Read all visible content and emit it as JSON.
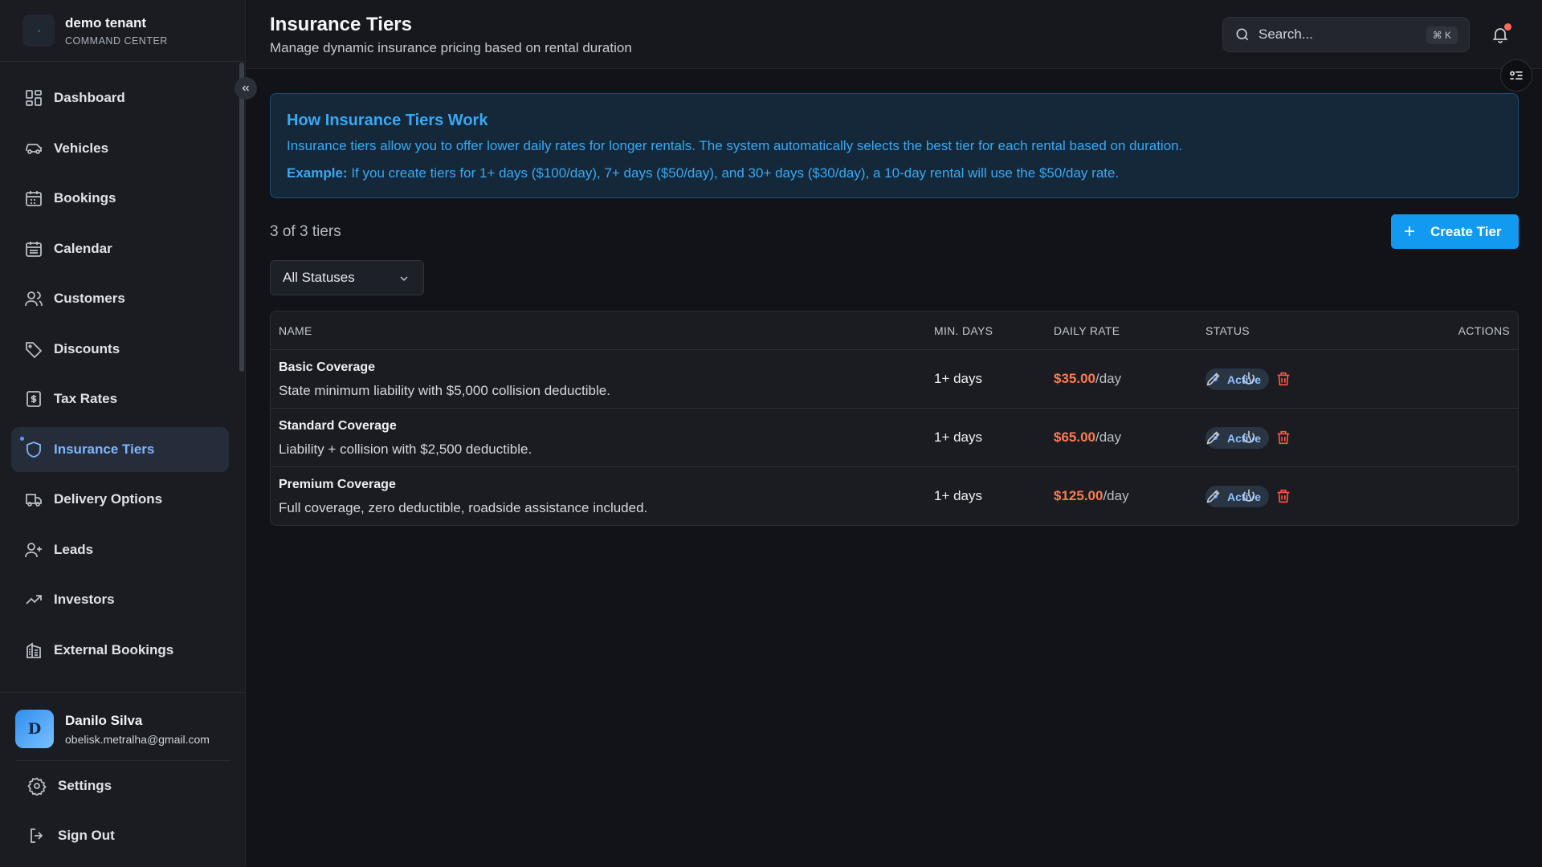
{
  "brand": {
    "title": "demo tenant",
    "subtitle": "COMMAND CENTER"
  },
  "sidebar": {
    "items": [
      {
        "label": "Dashboard",
        "icon": "dashboard-icon"
      },
      {
        "label": "Vehicles",
        "icon": "car-icon"
      },
      {
        "label": "Bookings",
        "icon": "calendar-icon"
      },
      {
        "label": "Calendar",
        "icon": "calendar-grid-icon"
      },
      {
        "label": "Customers",
        "icon": "users-icon"
      },
      {
        "label": "Discounts",
        "icon": "tag-icon"
      },
      {
        "label": "Tax Rates",
        "icon": "receipt-icon"
      },
      {
        "label": "Insurance Tiers",
        "icon": "shield-icon",
        "active": true
      },
      {
        "label": "Delivery Options",
        "icon": "truck-icon"
      },
      {
        "label": "Leads",
        "icon": "user-plus-icon"
      },
      {
        "label": "Investors",
        "icon": "trending-up-icon"
      },
      {
        "label": "External Bookings",
        "icon": "building-icon"
      }
    ],
    "user": {
      "initial": "D",
      "name": "Danilo Silva",
      "email": "obelisk.metralha@gmail.com"
    },
    "settings_label": "Settings",
    "signout_label": "Sign Out"
  },
  "header": {
    "title": "Insurance Tiers",
    "subtitle": "Manage dynamic insurance pricing based on rental duration",
    "search_placeholder": "Search...",
    "search_shortcut": "⌘ K"
  },
  "info": {
    "title": "How Insurance Tiers Work",
    "text": "Insurance tiers allow you to offer lower daily rates for longer rentals. The system automatically selects the best tier for each rental based on duration.",
    "example_label": "Example:",
    "example_text": " If you create tiers for 1+ days ($100/day), 7+ days ($50/day), and 30+ days ($30/day), a 10-day rental will use the $50/day rate."
  },
  "toolbar": {
    "count": "3 of 3 tiers",
    "create_label": "Create Tier",
    "status_filter": "All Statuses"
  },
  "table": {
    "columns": {
      "name": "NAME",
      "min_days": "MIN. DAYS",
      "daily_rate": "DAILY RATE",
      "status": "STATUS",
      "actions": "ACTIONS"
    },
    "rows": [
      {
        "name": "Basic Coverage",
        "description": "State minimum liability with $5,000 collision deductible.",
        "min_days": "1+ days",
        "rate": "$35.00",
        "rate_unit": "/day",
        "status": "Active"
      },
      {
        "name": "Standard Coverage",
        "description": "Liability + collision with $2,500 deductible.",
        "min_days": "1+ days",
        "rate": "$65.00",
        "rate_unit": "/day",
        "status": "Active"
      },
      {
        "name": "Premium Coverage",
        "description": "Full coverage, zero deductible, roadside assistance included.",
        "min_days": "1+ days",
        "rate": "$125.00",
        "rate_unit": "/day",
        "status": "Active"
      }
    ]
  },
  "colors": {
    "accent": "#1299f0",
    "rate": "#ff7a4f",
    "danger": "#ff5548",
    "info_text": "#3aa8f2"
  }
}
